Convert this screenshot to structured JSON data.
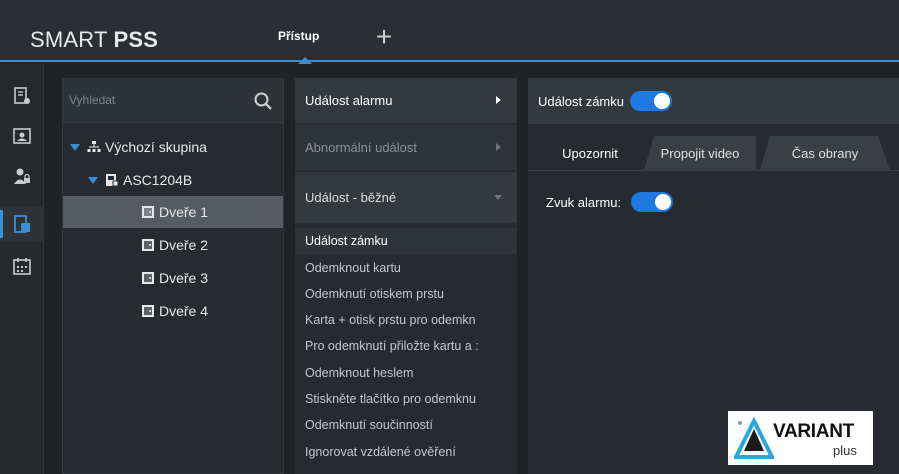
{
  "header": {
    "app_name_light": "SMART",
    "app_name_bold": "PSS",
    "active_tab": "Přístup",
    "add_tab_glyph": "+"
  },
  "colors": {
    "accent": "#3a8fd6",
    "toggle_on": "#1e7ae0",
    "selected_row": "#555b61"
  },
  "rail": {
    "items": [
      {
        "icon": "device-list-icon"
      },
      {
        "icon": "person-card-icon"
      },
      {
        "icon": "user-lock-icon"
      },
      {
        "icon": "door-access-icon",
        "active": true
      },
      {
        "icon": "calendar-icon"
      }
    ]
  },
  "tree": {
    "search_placeholder": "Vyhledat",
    "group": "Výchozí skupina",
    "device": "ASC1204B",
    "doors": [
      "Dveře 1",
      "Dveře 2",
      "Dveře 3",
      "Dveře 4"
    ],
    "selected_index": 0
  },
  "menu": {
    "alarm_event": "Událost alarmu",
    "abnormal_event": "Abnormální událost",
    "normal_event": "Událost - běžné",
    "sub_items": [
      "Událost zámku",
      "Odemknout kartu",
      "Odemknutí otiskem prstu",
      "Karta + otisk prstu pro odemkn",
      "Pro odemknutí přiložte kartu a :",
      "Odemknout heslem",
      "Stiskněte tlačítko pro odemknu",
      "Odemknutí součinností",
      "Ignorovat vzdálené ověření"
    ]
  },
  "detail": {
    "title": "Událost zámku",
    "title_toggle_on": true,
    "tabs": [
      "Upozornit",
      "Propojit video",
      "Čas obrany"
    ],
    "alarm_sound_label": "Zvuk alarmu:",
    "alarm_sound_on": true
  },
  "logo": {
    "brand": "VARIANT",
    "sub": "plus"
  }
}
